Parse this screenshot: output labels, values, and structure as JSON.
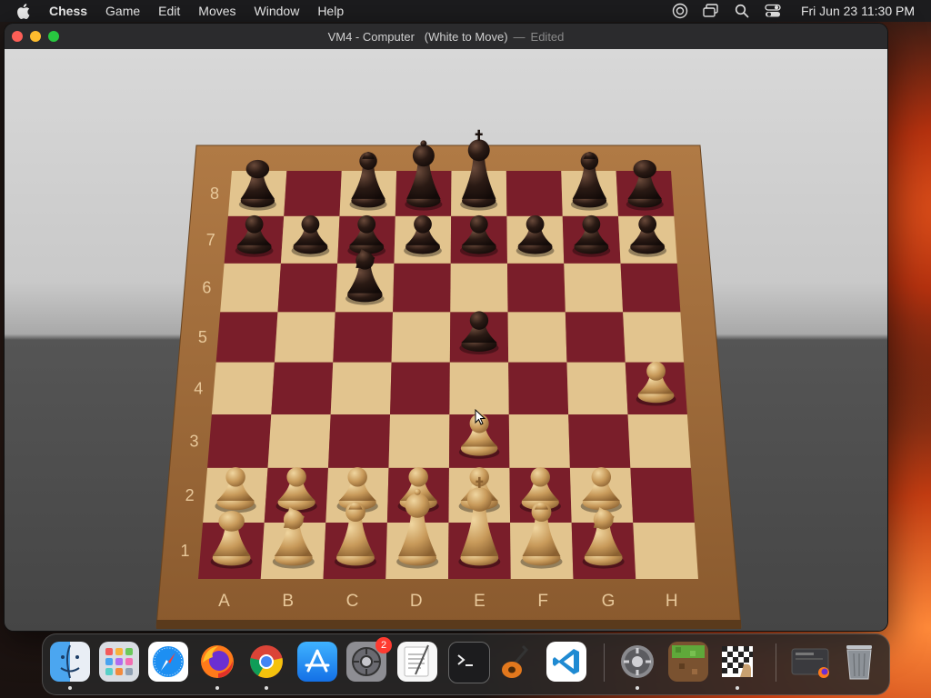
{
  "menubar": {
    "app_name": "Chess",
    "items": [
      "Game",
      "Edit",
      "Moves",
      "Window",
      "Help"
    ],
    "clock": "Fri Jun 23  11:30 PM"
  },
  "window": {
    "title": "VM4 - Computer   (White to Move)",
    "separator": "—",
    "status": "Edited"
  },
  "board": {
    "files": [
      "A",
      "B",
      "C",
      "D",
      "E",
      "F",
      "G",
      "H"
    ],
    "ranks": [
      "8",
      "7",
      "6",
      "5",
      "4",
      "3",
      "2",
      "1"
    ],
    "light_square": "#e2c48e",
    "dark_square": "#7a1e2a",
    "frame_color": "#9a6a3c",
    "pieces": [
      {
        "type": "rook",
        "color": "black",
        "square": "a8"
      },
      {
        "type": "bishop",
        "color": "black",
        "square": "c8"
      },
      {
        "type": "queen",
        "color": "black",
        "square": "d8"
      },
      {
        "type": "king",
        "color": "black",
        "square": "e8"
      },
      {
        "type": "bishop",
        "color": "black",
        "square": "g8"
      },
      {
        "type": "rook",
        "color": "black",
        "square": "h8"
      },
      {
        "type": "pawn",
        "color": "black",
        "square": "a7"
      },
      {
        "type": "pawn",
        "color": "black",
        "square": "b7"
      },
      {
        "type": "pawn",
        "color": "black",
        "square": "c7"
      },
      {
        "type": "pawn",
        "color": "black",
        "square": "d7"
      },
      {
        "type": "pawn",
        "color": "black",
        "square": "e7"
      },
      {
        "type": "pawn",
        "color": "black",
        "square": "f7"
      },
      {
        "type": "pawn",
        "color": "black",
        "square": "g7"
      },
      {
        "type": "pawn",
        "color": "black",
        "square": "h7"
      },
      {
        "type": "knight",
        "color": "black",
        "square": "c6"
      },
      {
        "type": "pawn",
        "color": "black",
        "square": "e5"
      },
      {
        "type": "pawn",
        "color": "white",
        "square": "h4"
      },
      {
        "type": "pawn",
        "color": "white",
        "square": "e3"
      },
      {
        "type": "pawn",
        "color": "white",
        "square": "a2"
      },
      {
        "type": "pawn",
        "color": "white",
        "square": "b2"
      },
      {
        "type": "pawn",
        "color": "white",
        "square": "c2"
      },
      {
        "type": "pawn",
        "color": "white",
        "square": "d2"
      },
      {
        "type": "pawn",
        "color": "white",
        "square": "e2"
      },
      {
        "type": "pawn",
        "color": "white",
        "square": "f2"
      },
      {
        "type": "pawn",
        "color": "white",
        "square": "g2"
      },
      {
        "type": "rook",
        "color": "white",
        "square": "a1"
      },
      {
        "type": "knight",
        "color": "white",
        "square": "b1"
      },
      {
        "type": "bishop",
        "color": "white",
        "square": "c1"
      },
      {
        "type": "queen",
        "color": "white",
        "square": "d1"
      },
      {
        "type": "king",
        "color": "white",
        "square": "e1"
      },
      {
        "type": "bishop",
        "color": "white",
        "square": "f1"
      },
      {
        "type": "knight",
        "color": "white",
        "square": "g1"
      }
    ]
  },
  "dock": {
    "items": [
      {
        "name": "finder-icon",
        "running": true
      },
      {
        "name": "launchpad-icon",
        "running": false
      },
      {
        "name": "safari-icon",
        "running": false
      },
      {
        "name": "firefox-icon",
        "running": true
      },
      {
        "name": "chrome-icon",
        "running": true
      },
      {
        "name": "app-store-icon",
        "running": false
      },
      {
        "name": "system-settings-icon",
        "running": false,
        "badge": "2"
      },
      {
        "name": "textedit-icon",
        "running": false
      },
      {
        "name": "terminal-icon",
        "running": false
      },
      {
        "name": "garageband-icon",
        "running": false
      },
      {
        "name": "vscode-icon",
        "running": false
      },
      {
        "name": "system-preferences-icon",
        "running": true
      },
      {
        "name": "minecraft-icon",
        "running": false
      },
      {
        "name": "chess-icon",
        "running": true
      },
      {
        "name": "downloads-folder-icon",
        "running": false
      },
      {
        "name": "trash-icon",
        "running": false
      }
    ]
  }
}
